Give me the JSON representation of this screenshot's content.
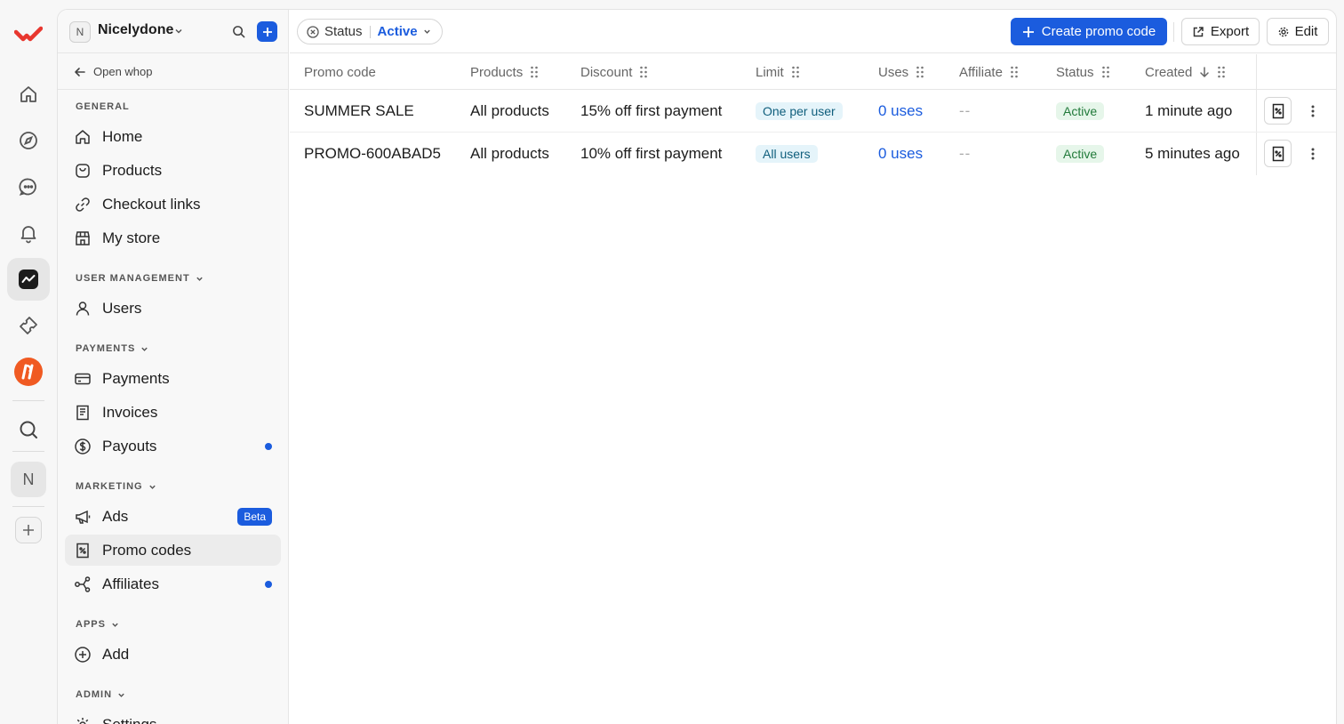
{
  "colors": {
    "accent": "#1b5cde",
    "brand": "#e8372f",
    "active_green": "#217a3a"
  },
  "rail": {
    "icons": [
      "home-icon",
      "compass-icon",
      "chat-icon",
      "bell-icon",
      "analytics-icon",
      "puzzle-icon",
      "app-logo-icon",
      "search-icon"
    ],
    "avatar_letter": "N"
  },
  "org": {
    "avatar_letter": "N",
    "name": "Nicelydone"
  },
  "sidebar": {
    "open_whop": "Open whop",
    "sections": {
      "general": "GENERAL",
      "user_management": "USER MANAGEMENT",
      "payments": "PAYMENTS",
      "marketing": "MARKETING",
      "apps": "APPS",
      "admin": "ADMIN"
    },
    "items": {
      "home": "Home",
      "products": "Products",
      "checkout_links": "Checkout links",
      "my_store": "My store",
      "users": "Users",
      "payments": "Payments",
      "invoices": "Invoices",
      "payouts": "Payouts",
      "ads": "Ads",
      "ads_badge": "Beta",
      "promo_codes": "Promo codes",
      "affiliates": "Affiliates",
      "add": "Add",
      "settings": "Settings"
    }
  },
  "toolbar": {
    "filter_label": "Status",
    "filter_value": "Active",
    "create_label": "Create promo code",
    "export_label": "Export",
    "edit_label": "Edit"
  },
  "table": {
    "columns": {
      "promo_code": "Promo code",
      "products": "Products",
      "discount": "Discount",
      "limit": "Limit",
      "uses": "Uses",
      "affiliate": "Affiliate",
      "status": "Status",
      "created": "Created"
    },
    "rows": [
      {
        "promo_code": "SUMMER SALE",
        "products": "All products",
        "discount": "15% off first payment",
        "limit": "One per user",
        "uses": "0 uses",
        "affiliate": "--",
        "status": "Active",
        "created": "1 minute ago"
      },
      {
        "promo_code": "PROMO-600ABAD5",
        "products": "All products",
        "discount": "10% off first payment",
        "limit": "All users",
        "uses": "0 uses",
        "affiliate": "--",
        "status": "Active",
        "created": "5 minutes ago"
      }
    ]
  }
}
